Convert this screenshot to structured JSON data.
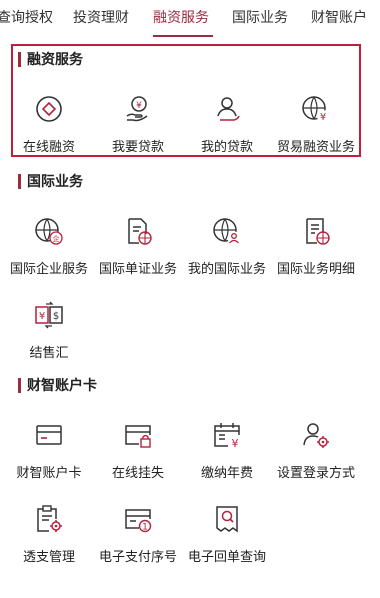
{
  "tabs": [
    {
      "label": "查询授权",
      "active": false
    },
    {
      "label": "投资理财",
      "active": false
    },
    {
      "label": "融资服务",
      "active": true
    },
    {
      "label": "国际业务",
      "active": false
    },
    {
      "label": "财智账户",
      "active": false
    }
  ],
  "sections": [
    {
      "title": "融资服务",
      "highlighted": true,
      "items": [
        {
          "label": "在线融资",
          "icon": "diamond-circle-icon"
        },
        {
          "label": "我要贷款",
          "icon": "yen-hand-icon"
        },
        {
          "label": "我的贷款",
          "icon": "user-hand-icon"
        },
        {
          "label": "贸易融资业务",
          "icon": "globe-yen-icon"
        }
      ]
    },
    {
      "title": "国际业务",
      "items": [
        {
          "label": "国际企业服务",
          "icon": "globe-enterprise-icon"
        },
        {
          "label": "国际单证业务",
          "icon": "document-globe-icon"
        },
        {
          "label": "我的国际业务",
          "icon": "globe-user-icon"
        },
        {
          "label": "国际业务明细",
          "icon": "document-detail-icon"
        },
        {
          "label": "结售汇",
          "icon": "currency-exchange-icon"
        }
      ]
    },
    {
      "title": "财智账户卡",
      "items": [
        {
          "label": "财智账户卡",
          "icon": "card-icon"
        },
        {
          "label": "在线挂失",
          "icon": "card-lock-icon"
        },
        {
          "label": "缴纳年费",
          "icon": "calendar-yen-icon"
        },
        {
          "label": "设置登录方式",
          "icon": "user-settings-icon"
        },
        {
          "label": "透支管理",
          "icon": "clipboard-settings-icon"
        },
        {
          "label": "电子支付序号",
          "icon": "card-number-icon"
        },
        {
          "label": "电子回单查询",
          "icon": "receipt-search-icon"
        }
      ]
    }
  ],
  "colors": {
    "accent": "#9b2c40",
    "highlight_border": "#c21d3b",
    "icon_stroke": "#333333",
    "icon_accent": "#b3243d"
  }
}
